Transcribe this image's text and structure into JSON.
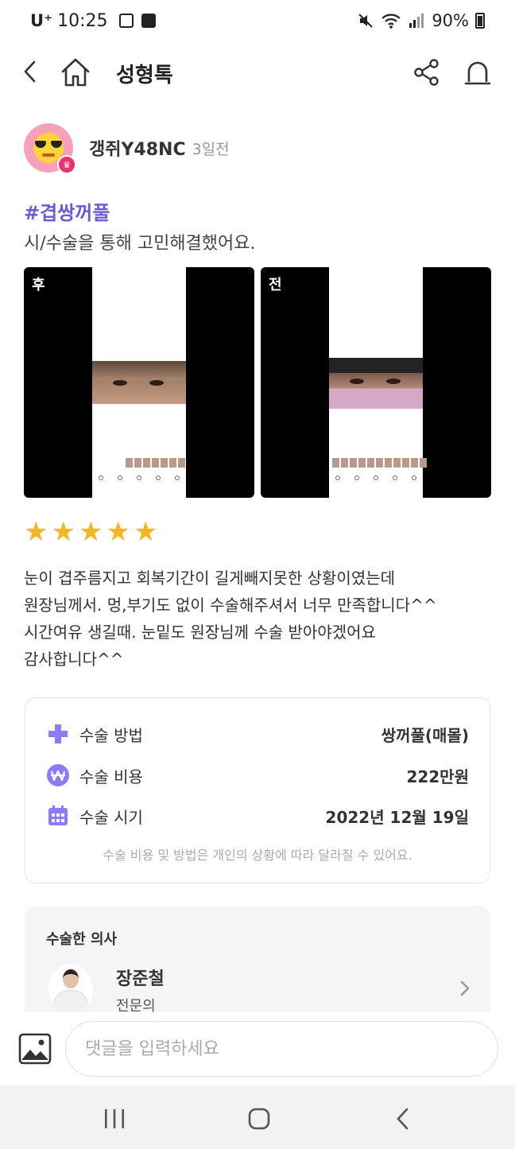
{
  "status_bar": {
    "carrier": "U⁺",
    "time": "10:25",
    "battery": "90%"
  },
  "header": {
    "title": "성형톡"
  },
  "post": {
    "author": {
      "name": "갱쥐Y48NC",
      "time_ago": "3일전"
    },
    "hashtag": "#겹쌍꺼풀",
    "subtitle": "시/수술을 통해 고민해결했어요.",
    "photos": [
      {
        "label": "후"
      },
      {
        "label": "전"
      }
    ],
    "rating": {
      "value": 5,
      "max": 5
    },
    "review_lines": [
      "눈이 겹주름지고 회복기간이 길게빼지못한 상황이였는데",
      "원장님께서. 멍,부기도 없이 수술해주셔서 너무 만족합니다^^",
      "시간여유 생길때. 눈밑도 원장님께 수술 받아야겠어요",
      "감사합니다^^"
    ]
  },
  "surgery_info": {
    "rows": [
      {
        "icon": "plus-cross-icon",
        "label": "수술 방법",
        "value": "쌍꺼풀(매몰)"
      },
      {
        "icon": "won-coin-icon",
        "label": "수술 비용",
        "value": "222만원"
      },
      {
        "icon": "calendar-icon",
        "label": "수술 시기",
        "value": "2022년 12월 19일"
      }
    ],
    "note": "수술 비용 및 방법은 개인의 상황에 따라 달라질 수 있어요."
  },
  "doctor": {
    "heading": "수술한 의사",
    "name": "장준철",
    "role": "전문의"
  },
  "comment": {
    "placeholder": "댓글을 입력하세요"
  },
  "colors": {
    "accent": "#6b5bd3",
    "icon_purple": "#8b7cf6",
    "star": "#f5b624"
  }
}
